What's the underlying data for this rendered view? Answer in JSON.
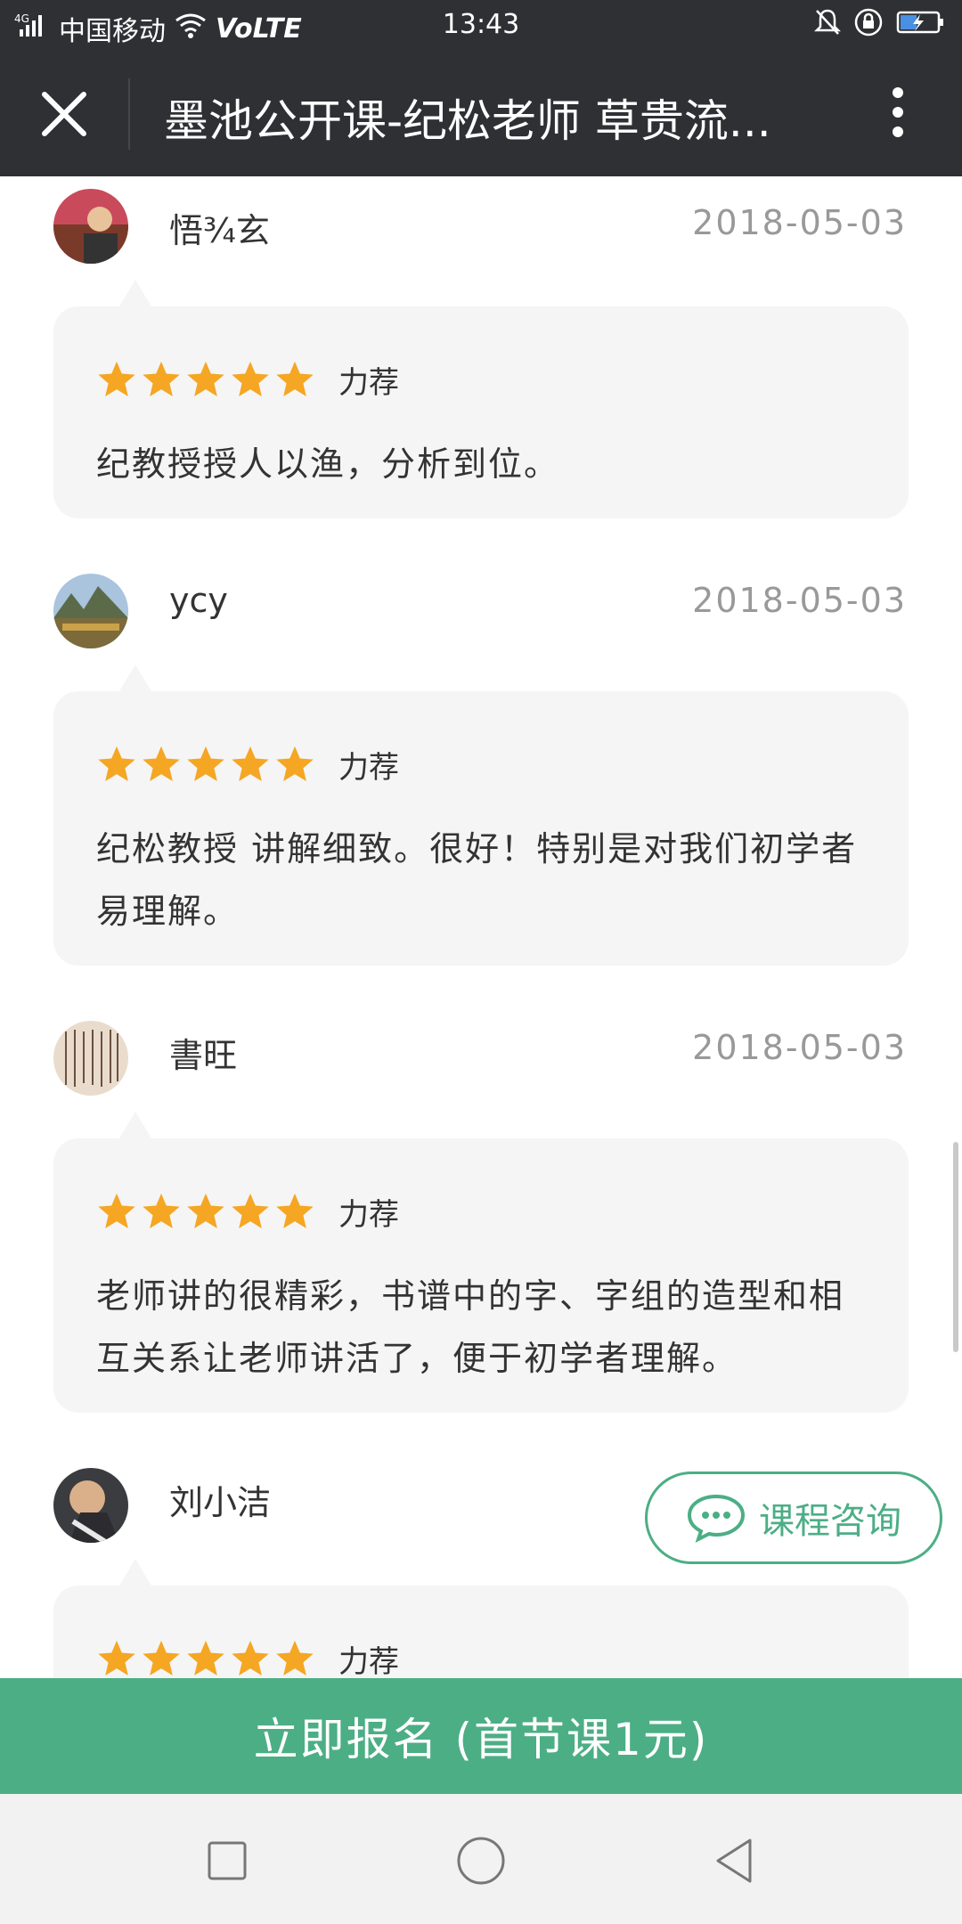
{
  "status_bar": {
    "network": "4G",
    "carrier": "中国移动",
    "volte": "VoLTE",
    "time": "13:43"
  },
  "header": {
    "title": "墨池公开课-纪松老师 草贵流..."
  },
  "reviews": [
    {
      "name": "悟¾玄",
      "date": "2018-05-03",
      "rating": 5,
      "rating_label": "力荐",
      "text": "纪教授授人以渔，分析到位。"
    },
    {
      "name": "ycy",
      "date": "2018-05-03",
      "rating": 5,
      "rating_label": "力荐",
      "text": "纪松教授 讲解细致。很好！特别是对我们初学者易理解。"
    },
    {
      "name": "書旺",
      "date": "2018-05-03",
      "rating": 5,
      "rating_label": "力荐",
      "text": "老师讲的很精彩，书谱中的字、字组的造型和相互关系让老师讲活了，便于初学者理解。"
    },
    {
      "name": "刘小洁",
      "date": "",
      "rating": 5,
      "rating_label": "力荐",
      "text": ""
    }
  ],
  "consult_button": {
    "label": "课程咨询"
  },
  "enroll_button": {
    "label": "立即报名 (首节课1元)"
  },
  "colors": {
    "header_bg": "#2f3034",
    "accent_green": "#4cae85",
    "star_orange": "#f5a623",
    "bubble_bg": "#f5f5f5",
    "date_gray": "#999999"
  }
}
